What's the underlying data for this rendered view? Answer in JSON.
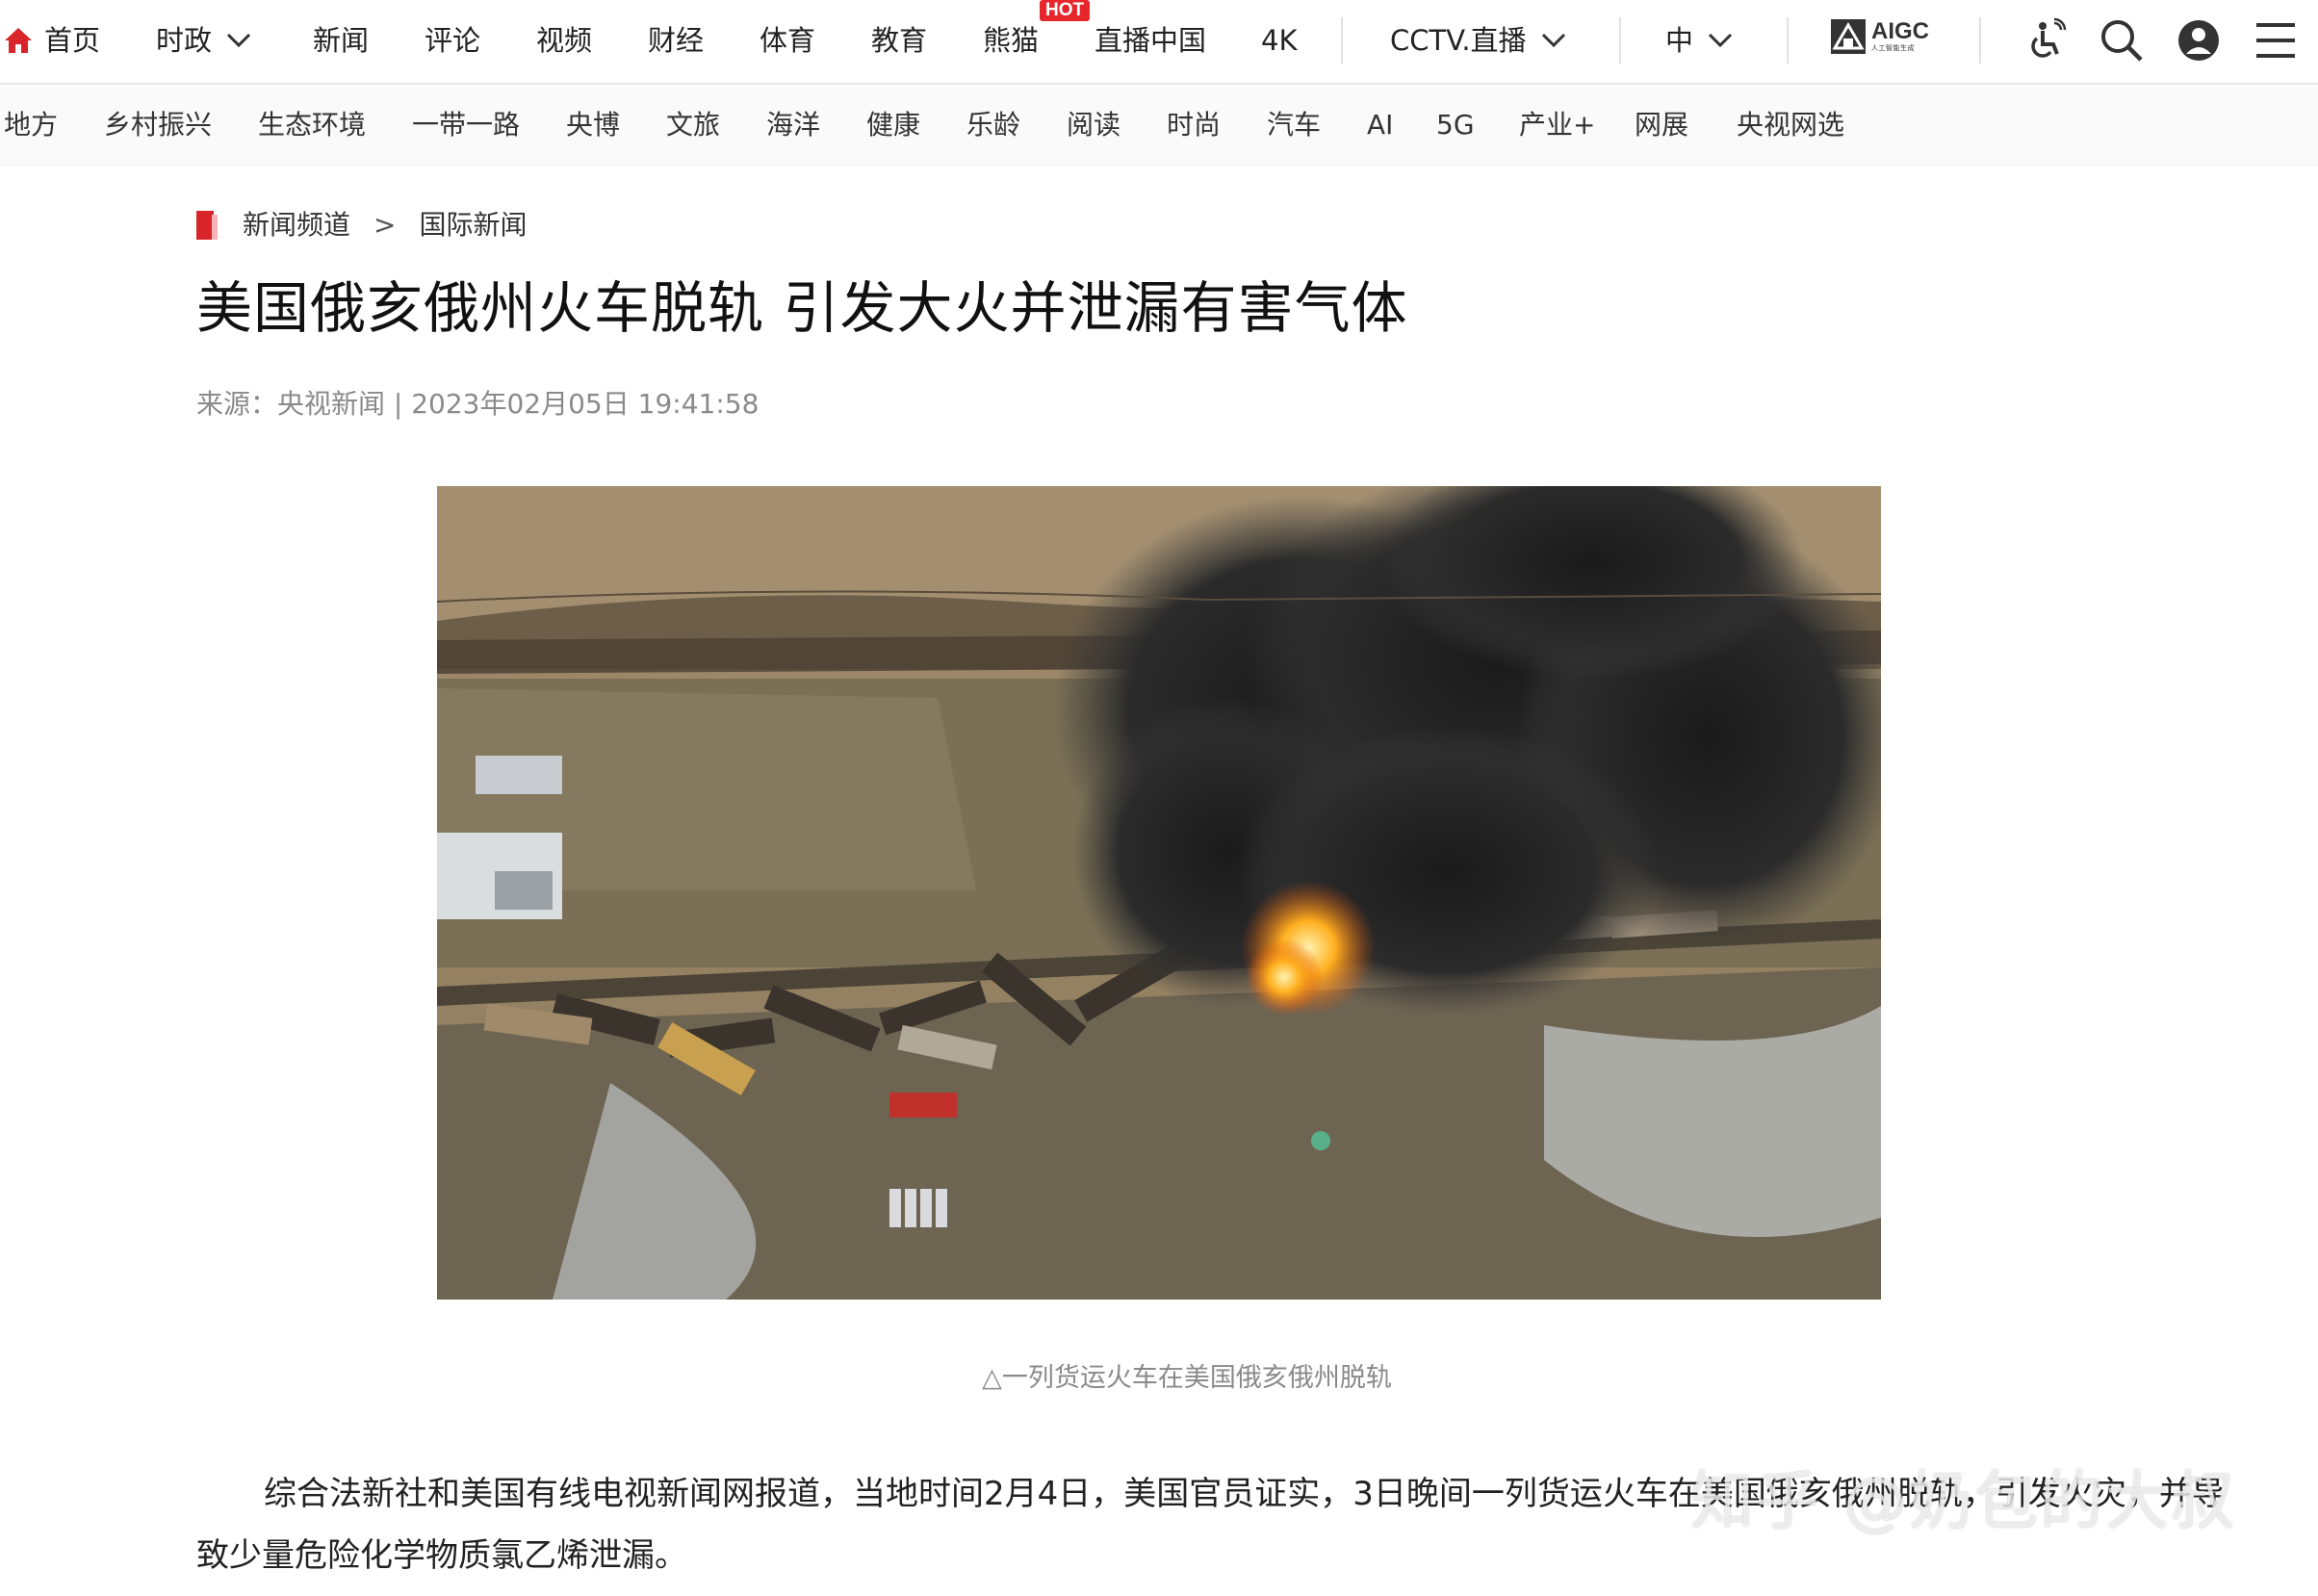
{
  "topnav": {
    "home": "首页",
    "items": [
      "时政",
      "新闻",
      "评论",
      "视频",
      "财经",
      "体育",
      "教育",
      "熊猫",
      "直播中国",
      "4K",
      "CCTV.直播",
      "中"
    ],
    "hot_badge": "HOT",
    "aigc_label": "AIGC",
    "aigc_sub": "人工智能生成"
  },
  "subnav": {
    "items": [
      "地方",
      "乡村振兴",
      "生态环境",
      "一带一路",
      "央博",
      "文旅",
      "海洋",
      "健康",
      "乐龄",
      "阅读",
      "时尚",
      "汽车",
      "AI",
      "5G",
      "产业+",
      "网展",
      "央视网选"
    ]
  },
  "article": {
    "breadcrumb": [
      "新闻频道",
      ">",
      "国际新闻"
    ],
    "title": "美国俄亥俄州火车脱轨 引发大火并泄漏有害气体",
    "meta": "来源：央视新闻 | 2023年02月05日 19:41:58",
    "photo_alt": "aerial-train-derailment-fire",
    "caption": "△一列货运火车在美国俄亥俄州脱轨",
    "paragraph": "综合法新社和美国有线电视新闻网报道，当地时间2月4日，美国官员证实，3日晚间一列货运火车在美国俄亥俄州脱轨，引发火灾，并导致少量危险化学物质氯乙烯泄漏。"
  },
  "watermark": "知乎 @奶包的大叔",
  "colors": {
    "accent": "#d9252a",
    "hot": "#e6262b",
    "meta": "#8a8a8a"
  }
}
